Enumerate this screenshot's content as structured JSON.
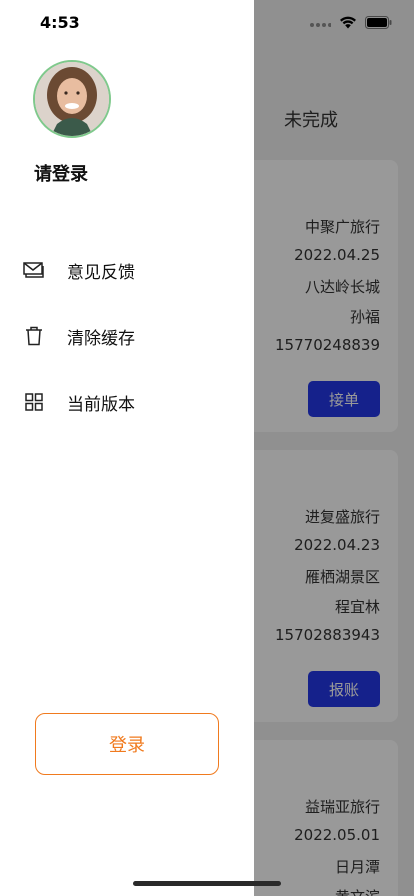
{
  "status_bar": {
    "time": "4:53"
  },
  "drawer": {
    "login_title": "请登录",
    "menu": [
      {
        "label": "意见反馈",
        "icon": "mail-icon"
      },
      {
        "label": "清除缓存",
        "icon": "trash-icon"
      },
      {
        "label": "当前版本",
        "icon": "grid-icon"
      }
    ],
    "login_button": "登录"
  },
  "background": {
    "tab": "未完成",
    "orders": [
      {
        "agency": "中聚广旅行",
        "date": "2022.04.25",
        "destination": "八达岭长城",
        "guide": "孙福",
        "phone": "15770248839",
        "action": "接单"
      },
      {
        "agency": "进复盛旅行",
        "date": "2022.04.23",
        "destination": "雁栖湖景区",
        "guide": "程宜林",
        "phone": "15702883943",
        "action": "报账"
      },
      {
        "agency": "益瑞亚旅行",
        "date": "2022.05.01",
        "destination": "日月潭",
        "guide": "黄文滨"
      }
    ]
  },
  "colors": {
    "accent_orange": "#f07a1e",
    "button_blue": "#2438e8",
    "avatar_border": "#7fc98c"
  }
}
